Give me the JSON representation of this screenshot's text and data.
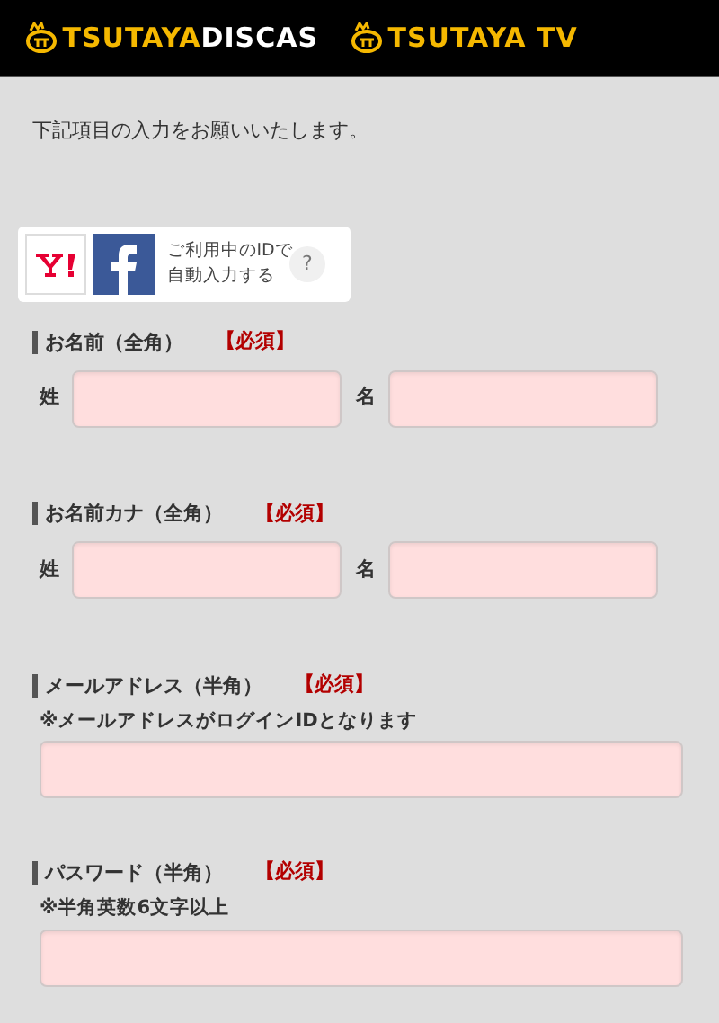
{
  "header": {
    "logos": [
      {
        "brand": "TSUTAYA",
        "product": "DISCAS"
      },
      {
        "brand": "TSUTAYA",
        "product": " TV"
      }
    ]
  },
  "intro": "下記項目の入力をお願いいたします。",
  "social_login": {
    "text_lines": [
      "ご利用中のIDで",
      "自動入力する"
    ],
    "help": "?"
  },
  "sections": [
    {
      "kind": "name-pair",
      "label": "お名前（全角）",
      "required": "【必須】",
      "fields": [
        {
          "label": "姓"
        },
        {
          "label": "名"
        }
      ]
    },
    {
      "kind": "name-pair",
      "label": "お名前カナ（全角）",
      "required": "【必須】",
      "fields": [
        {
          "label": "姓"
        },
        {
          "label": "名"
        }
      ]
    },
    {
      "kind": "single",
      "label": "メールアドレス（半角）",
      "required": "【必須】",
      "note": "※メールアドレスがログインIDとなります"
    },
    {
      "kind": "single",
      "label": "パスワード（半角）",
      "required": "【必須】",
      "note": "※半角英数6文字以上"
    }
  ]
}
